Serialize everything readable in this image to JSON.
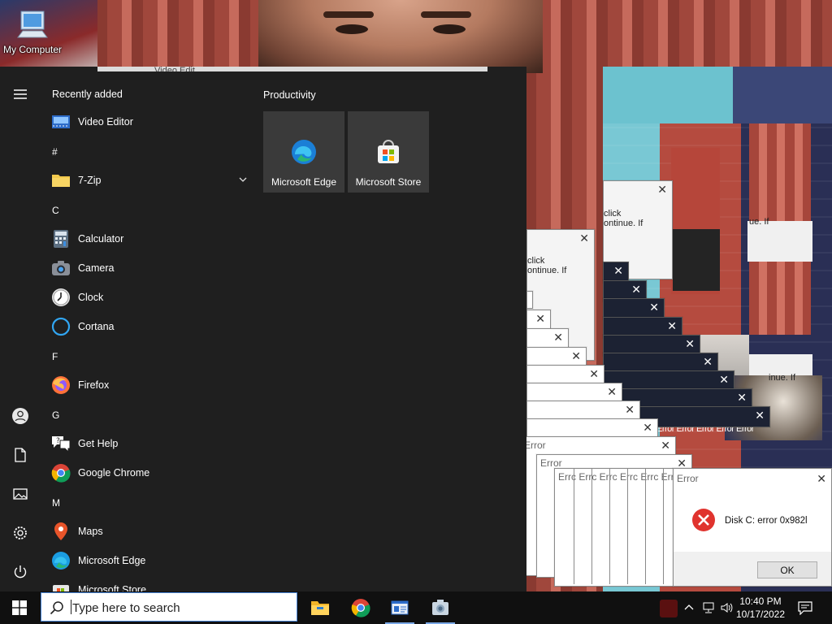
{
  "desktop": {
    "icons": [
      {
        "label": "My Computer"
      }
    ],
    "background_partial_text": "Video Edit"
  },
  "start_menu": {
    "recently_added_label": "Recently added",
    "productivity_label": "Productivity",
    "items": [
      {
        "type": "app",
        "label": "Video Editor",
        "icon": "video-editor-icon"
      },
      {
        "type": "section",
        "label": "#"
      },
      {
        "type": "app",
        "label": "7-Zip",
        "icon": "folder-icon",
        "expandable": true
      },
      {
        "type": "section",
        "label": "C"
      },
      {
        "type": "app",
        "label": "Calculator",
        "icon": "calculator-icon"
      },
      {
        "type": "app",
        "label": "Camera",
        "icon": "camera-icon"
      },
      {
        "type": "app",
        "label": "Clock",
        "icon": "clock-icon"
      },
      {
        "type": "app",
        "label": "Cortana",
        "icon": "cortana-icon"
      },
      {
        "type": "section",
        "label": "F"
      },
      {
        "type": "app",
        "label": "Firefox",
        "icon": "firefox-icon"
      },
      {
        "type": "section",
        "label": "G"
      },
      {
        "type": "app",
        "label": "Get Help",
        "icon": "get-help-icon"
      },
      {
        "type": "app",
        "label": "Google Chrome",
        "icon": "chrome-icon"
      },
      {
        "type": "section",
        "label": "M"
      },
      {
        "type": "app",
        "label": "Maps",
        "icon": "maps-icon"
      },
      {
        "type": "app",
        "label": "Microsoft Edge",
        "icon": "edge-icon"
      },
      {
        "type": "app",
        "label": "Microsoft Store",
        "icon": "store-icon"
      }
    ],
    "tiles": [
      {
        "label": "Microsoft Edge",
        "icon": "edge-icon"
      },
      {
        "label": "Microsoft Store",
        "icon": "store-icon"
      }
    ],
    "rail_icons": [
      "hamburger-menu-icon",
      "user-icon",
      "documents-icon",
      "pictures-icon",
      "settings-icon",
      "power-icon"
    ]
  },
  "error_dialogs": {
    "title": "Error",
    "message": "Disk C: error 0x982l",
    "ok_label": "OK",
    "fragment_1": "click",
    "fragment_2": "ontinue. If",
    "fragment_3": "ontinue. If",
    "fragment_4": "ue. If",
    "fragment_5": "inue. If",
    "stack_titles": "Errc Errc Errc Errc Errc Errc Er",
    "stack_tabs_glitch": "Error Error Error Error Error"
  },
  "taskbar": {
    "search_placeholder": "Type here to search",
    "apps": [
      "file-explorer-icon",
      "chrome-icon",
      "window-app-icon",
      "image-viewer-icon"
    ],
    "time": "10:40 PM",
    "date": "10/17/2022"
  },
  "colors": {
    "start_bg": "#1f1f1f",
    "tile_bg": "#3a3a3a",
    "taskbar_bg": "#101010",
    "accent": "#4a86d8",
    "error_red": "#e0332e"
  }
}
